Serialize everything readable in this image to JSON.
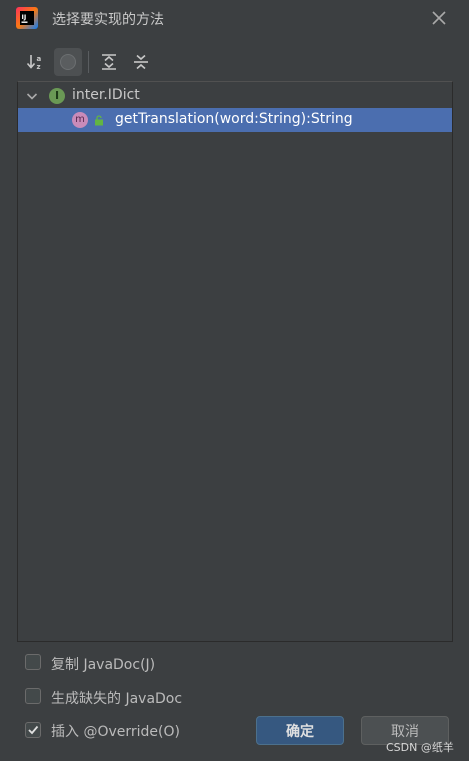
{
  "window": {
    "title": "选择要实现的方法"
  },
  "toolbar": {
    "buttons": [
      {
        "icon": "sort-alphabetically-icon"
      },
      {
        "icon": "show-classes-icon",
        "pressed": true
      },
      {
        "icon": "expand-all-icon"
      },
      {
        "icon": "collapse-all-icon"
      }
    ]
  },
  "tree": {
    "root": {
      "label": "inter.IDict",
      "badge": "I",
      "expanded": true
    },
    "method": {
      "label": "getTranslation(word:String):String",
      "badge": "m",
      "selected": true
    }
  },
  "options": [
    {
      "label": "复制 JavaDoc(J)",
      "checked": false
    },
    {
      "label": "生成缺失的 JavaDoc",
      "checked": false
    },
    {
      "label": "插入 @Override(O)",
      "checked": true
    }
  ],
  "buttons": {
    "ok": "确定",
    "cancel": "取消"
  },
  "watermark": "CSDN @纸羊",
  "colors": {
    "selection": "#4b6eaf",
    "background": "#3c3f41",
    "interface_badge": "#6a9955",
    "method_badge": "#c98bb9",
    "ok_button": "#365880"
  }
}
